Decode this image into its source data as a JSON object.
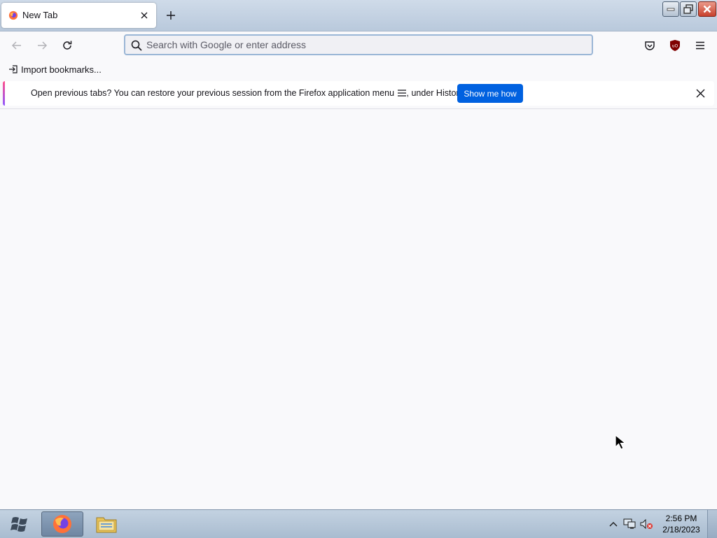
{
  "tab": {
    "title": "New Tab",
    "favicon": "firefox-icon"
  },
  "window_controls": [
    "minimize-icon",
    "maximize-icon",
    "close-icon"
  ],
  "urlbar": {
    "placeholder": "Search with Google or enter address",
    "value": ""
  },
  "bookmarks": {
    "import_label": "Import bookmarks..."
  },
  "notification": {
    "lead": "Open previous tabs?",
    "body_before_icon": " You can restore your previous session from the Firefox application menu ",
    "body_after_icon": ", under History.",
    "button_label": "Show me how"
  },
  "taskbar": {
    "apps": [
      "firefox-icon",
      "file-explorer-icon"
    ],
    "clock_time": "2:56 PM",
    "clock_date": "2/18/2023"
  },
  "colors": {
    "accent": "#0061e0",
    "notification_gradient_top": "#ff4f8b",
    "notification_gradient_bottom": "#9059ff",
    "extension_ublock": "#800000"
  }
}
